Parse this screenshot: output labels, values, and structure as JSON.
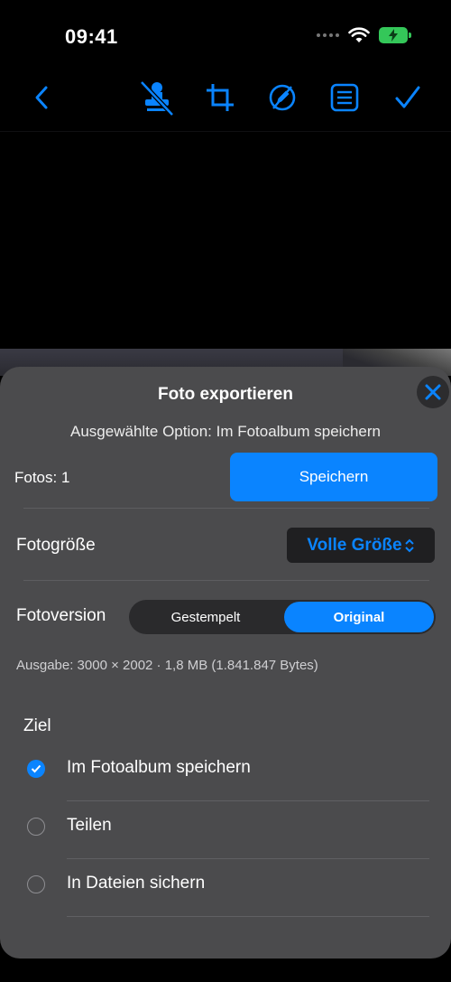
{
  "status_bar": {
    "time": "09:41"
  },
  "toolbar": {
    "icons": [
      "back-icon",
      "stamp-off-icon",
      "crop-icon",
      "edit-off-icon",
      "list-icon",
      "checkmark-icon"
    ],
    "accent": "#0a84ff"
  },
  "sheet": {
    "title": "Foto exportieren",
    "subtitle": "Ausgewählte Option: Im Fotoalbum speichern",
    "fotos_label": "Fotos: 1",
    "save_label": "Speichern",
    "size_label": "Fotogröße",
    "size_value": "Volle Größe",
    "version_label": "Fotoversion",
    "version_options": [
      "Gestempelt",
      "Original"
    ],
    "version_selected": "Original",
    "output_info": "Ausgabe: 3000 × 2002 · 1,8 MB (1.841.847 Bytes)",
    "destination_heading": "Ziel",
    "destinations": [
      {
        "label": "Im Fotoalbum speichern",
        "checked": true
      },
      {
        "label": "Teilen",
        "checked": false
      },
      {
        "label": "In Dateien sichern",
        "checked": false
      }
    ]
  },
  "colors": {
    "accent": "#0a84ff",
    "sheet_bg": "#4b4b4d",
    "battery": "#34c759"
  }
}
